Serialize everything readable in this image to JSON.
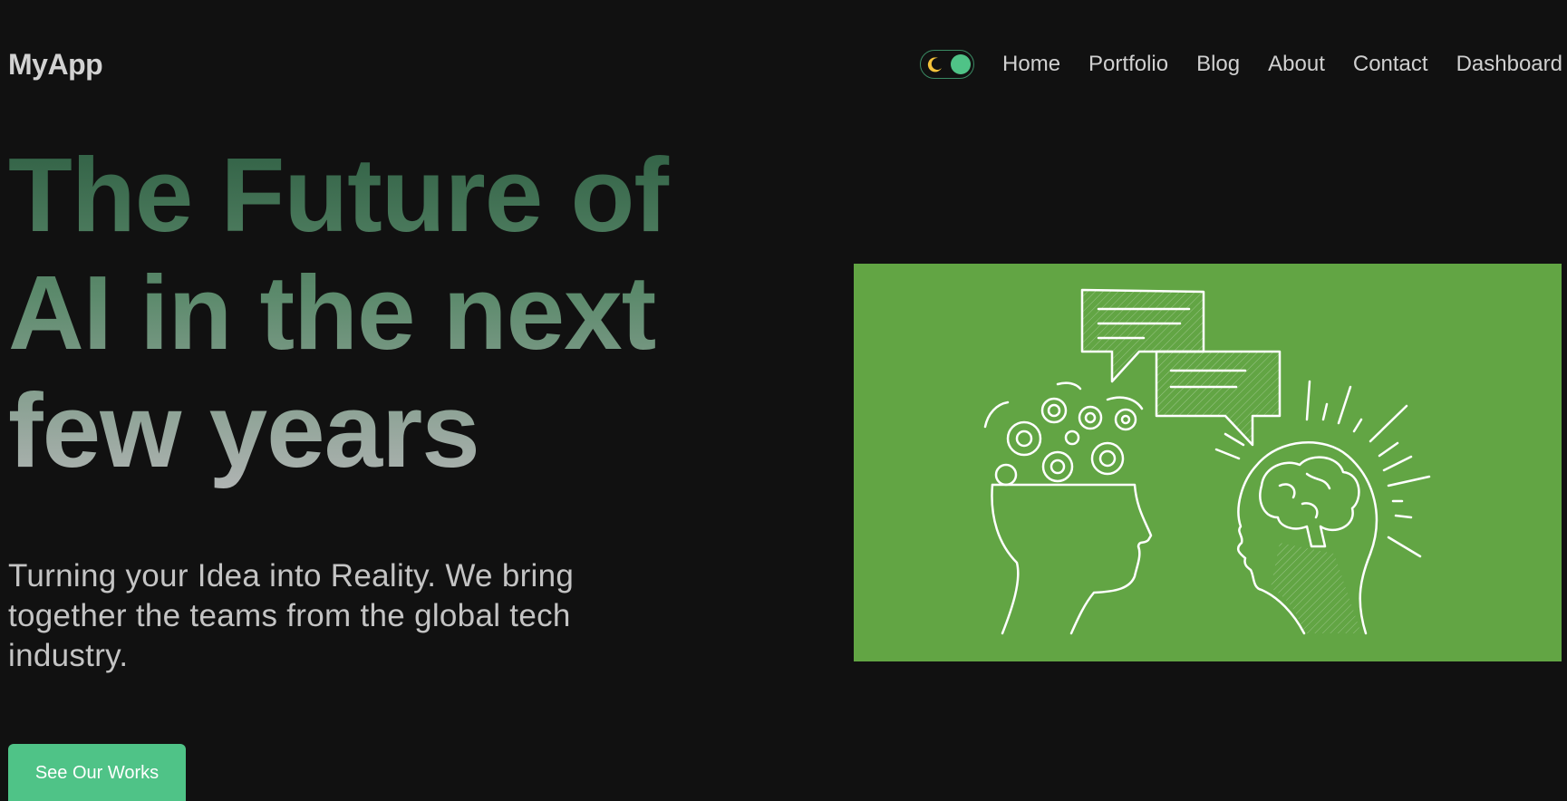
{
  "header": {
    "brand": "MyApp",
    "nav": {
      "items": [
        {
          "label": "Home"
        },
        {
          "label": "Portfolio"
        },
        {
          "label": "Blog"
        },
        {
          "label": "About"
        },
        {
          "label": "Contact"
        },
        {
          "label": "Dashboard"
        }
      ]
    },
    "theme_toggle": {
      "icon": "moon-icon",
      "state": "dark"
    }
  },
  "hero": {
    "title_lines": [
      "The Future of",
      "AI in the next",
      "few years"
    ],
    "subtitle": "Turning your Idea into Reality. We bring together the teams from the global tech industry.",
    "cta_label": "See Our Works",
    "illustration": "ai-heads-illustration"
  },
  "colors": {
    "background": "#111111",
    "accent": "#4fc387",
    "illustration_bg": "#62a544",
    "text_muted": "#c4c4c4"
  }
}
